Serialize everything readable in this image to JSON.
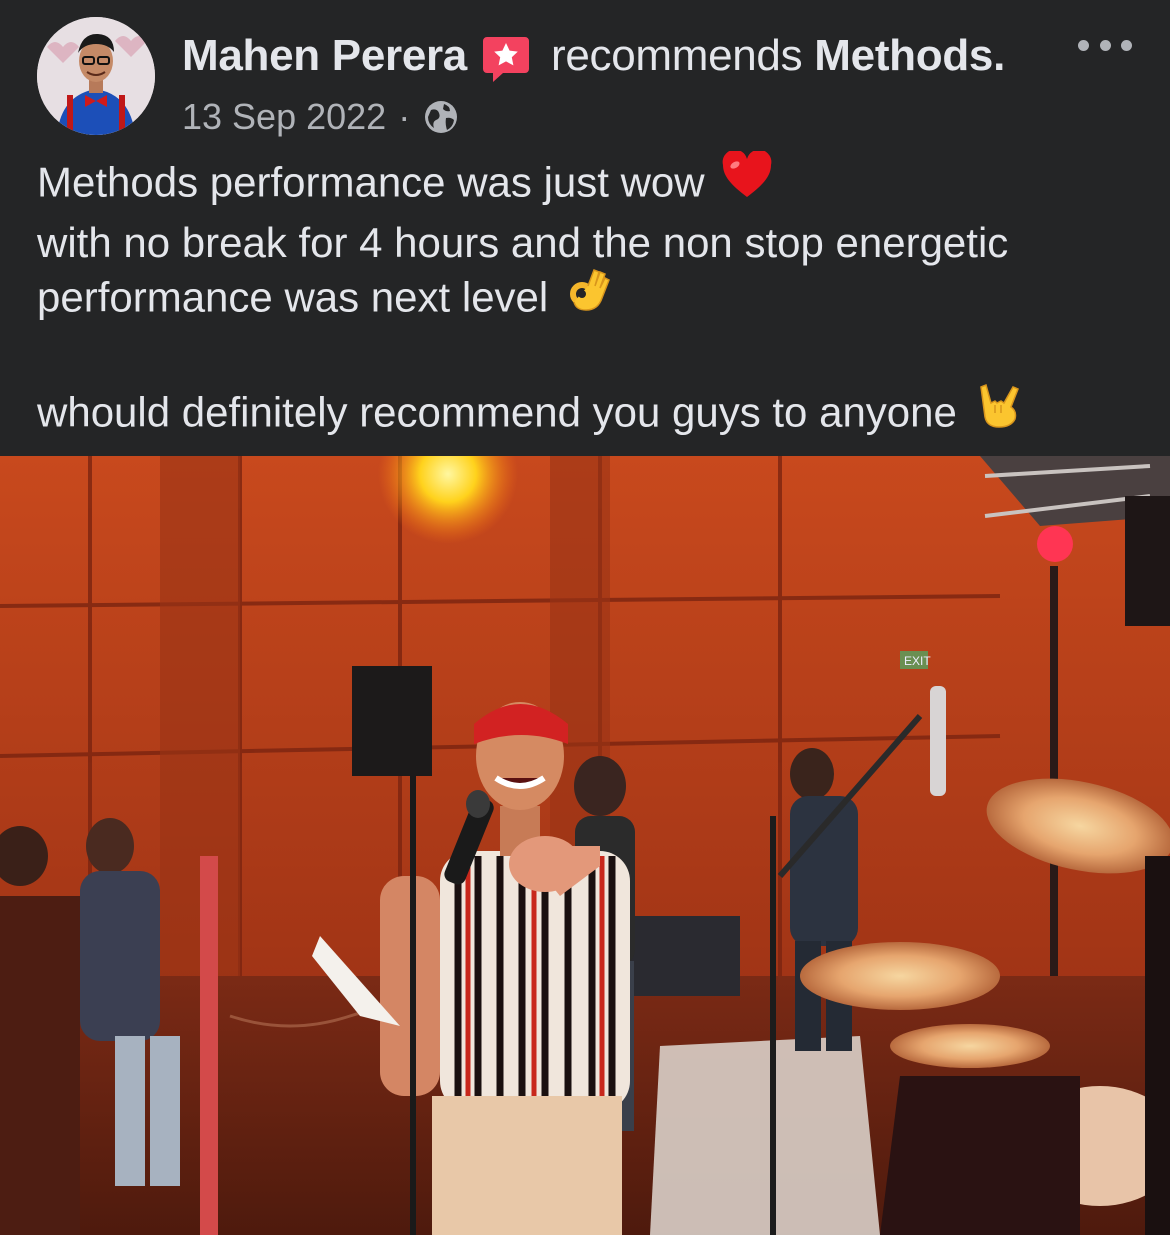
{
  "post": {
    "author_name": "Mahen Perera",
    "recommends_word": "recommends",
    "page_name": "Methods.",
    "date": "13 Sep 2022",
    "separator": "·",
    "audience_icon": "globe-icon",
    "recommend_badge_icon": "star-speech-bubble-icon",
    "more_icon": "more-dots-icon",
    "body_lines": [
      "Methods performance was just wow",
      "with no break for 4 hours and the non stop energetic",
      "performance was next level",
      "whould definitely recommend you guys to anyone"
    ],
    "emojis": [
      "red-heart-icon",
      "ok-hand-icon",
      "rock-on-hand-icon"
    ],
    "photo": {
      "description_icon": "concert-photo",
      "exit_sign": "EXIT"
    }
  },
  "colors": {
    "background": "#242526",
    "primary_text": "#e4e6eb",
    "secondary_text": "#b0b3b8",
    "recommend_badge": "#f3425f"
  }
}
